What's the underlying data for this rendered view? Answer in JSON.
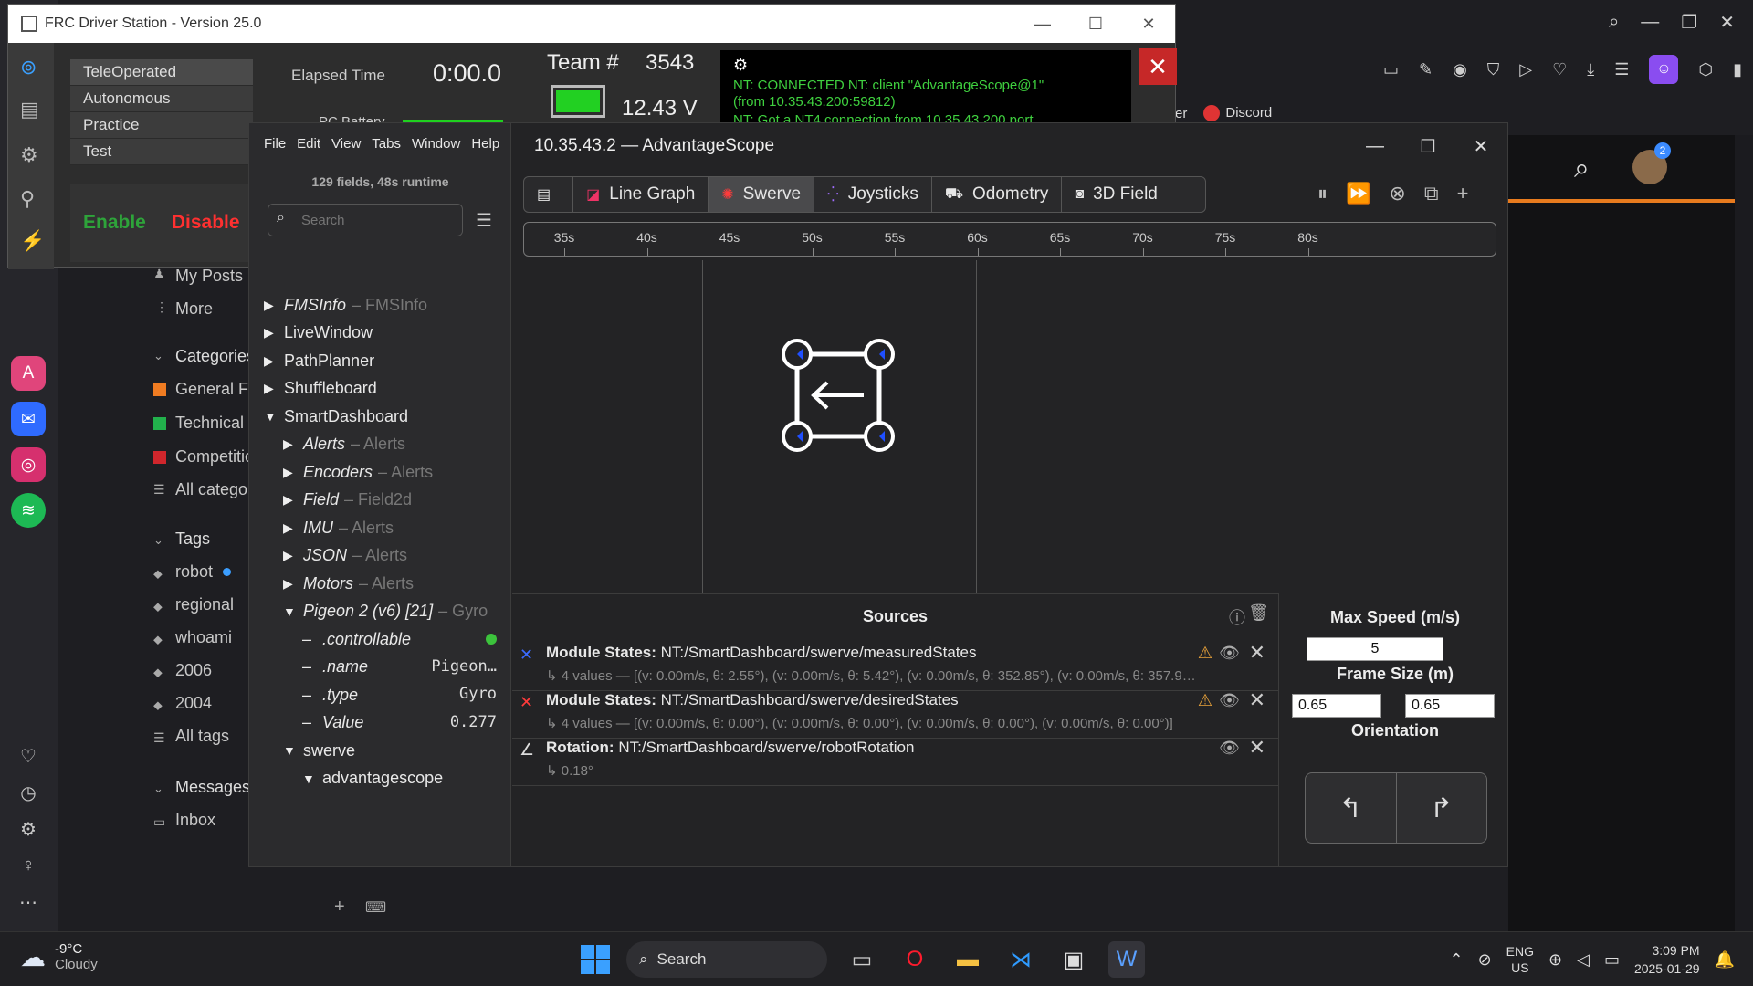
{
  "colors": {
    "green": "#2ecc40",
    "red": "#ff3030",
    "accent_orange": "#e87b1e",
    "module_blue": "#1f4fff"
  },
  "browser": {
    "bookmarks": [
      "ender",
      "Discord"
    ],
    "forum_nav": {
      "my_posts": "My Posts",
      "more": "More",
      "categories_heading": "Categories",
      "categories": [
        "General Fo",
        "Technical",
        "Competitio",
        "All categor"
      ],
      "tags_heading": "Tags",
      "tags": [
        "robot",
        "regional",
        "whoami",
        "2006",
        "2004",
        "All tags"
      ],
      "messages_heading": "Messages",
      "inbox": "Inbox"
    },
    "notification_count": "2"
  },
  "driver_station": {
    "title": "FRC Driver Station - Version 25.0",
    "modes": [
      "TeleOperated",
      "Autonomous",
      "Practice",
      "Test"
    ],
    "enable": "Enable",
    "disable": "Disable",
    "elapsed_label": "Elapsed Time",
    "elapsed_value": "0:00.0",
    "pc_battery_label": "PC Battery",
    "team_label": "Team #",
    "team_number": "3543",
    "voltage": "12.43 V",
    "log_lines": [
      "NT: CONNECTED NT: client \"AdvantageScope@1\"",
      "(from 10.35.43.200:59812)",
      "NT: Got a NT4 connection from 10.35.43.200 port"
    ]
  },
  "advantagescope": {
    "title": "10.35.43.2 — AdvantageScope",
    "menu": [
      "File",
      "Edit",
      "View",
      "Tabs",
      "Window",
      "Help"
    ],
    "fields_info": "129 fields, 48s runtime",
    "search_placeholder": "Search",
    "tree": [
      {
        "label": "FMSInfo",
        "type": "FMSInfo",
        "italic": true,
        "expanded": false,
        "indent": 0
      },
      {
        "label": "LiveWindow",
        "type": "",
        "italic": false,
        "expanded": false,
        "indent": 0
      },
      {
        "label": "PathPlanner",
        "type": "",
        "italic": false,
        "expanded": false,
        "indent": 0
      },
      {
        "label": "Shuffleboard",
        "type": "",
        "italic": false,
        "expanded": false,
        "indent": 0
      },
      {
        "label": "SmartDashboard",
        "type": "",
        "italic": false,
        "expanded": true,
        "indent": 0
      },
      {
        "label": "Alerts",
        "type": "Alerts",
        "italic": true,
        "expanded": false,
        "indent": 1
      },
      {
        "label": "Encoders",
        "type": "Alerts",
        "italic": true,
        "expanded": false,
        "indent": 1
      },
      {
        "label": "Field",
        "type": "Field2d",
        "italic": true,
        "expanded": false,
        "indent": 1
      },
      {
        "label": "IMU",
        "type": "Alerts",
        "italic": true,
        "expanded": false,
        "indent": 1
      },
      {
        "label": "JSON",
        "type": "Alerts",
        "italic": true,
        "expanded": false,
        "indent": 1
      },
      {
        "label": "Motors",
        "type": "Alerts",
        "italic": true,
        "expanded": false,
        "indent": 1
      },
      {
        "label": "Pigeon 2 (v6) [21]",
        "type": "Gyro",
        "italic": true,
        "expanded": true,
        "indent": 1
      }
    ],
    "leaves": [
      {
        "label": ".controllable",
        "value": "",
        "dot": true
      },
      {
        "label": ".name",
        "value": "Pigeon…",
        "dot": false
      },
      {
        "label": ".type",
        "value": "Gyro",
        "dot": false
      },
      {
        "label": "Value",
        "value": "0.277",
        "dot": false
      }
    ],
    "tree_tail": [
      {
        "label": "swerve",
        "indent": 1
      },
      {
        "label": "advantagescope",
        "indent": 2
      }
    ],
    "tabs": [
      "",
      "Line Graph",
      "Swerve",
      "Joysticks",
      "Odometry",
      "3D Field"
    ],
    "active_tab": "Swerve",
    "timeline_ticks": [
      "35s",
      "40s",
      "45s",
      "50s",
      "55s",
      "60s",
      "65s",
      "70s",
      "75s",
      "80s"
    ],
    "sources_title": "Sources",
    "sources": [
      {
        "kind": "Module States:",
        "path": "NT:/SmartDashboard/swerve/measuredStates",
        "detail": "↳ 4 values — [(v: 0.00m/s, θ: 2.55°), (v: 0.00m/s, θ: 5.42°), (v: 0.00m/s, θ: 352.85°), (v: 0.00m/s, θ: 357.9…",
        "color": "#3b6bff",
        "warn": true
      },
      {
        "kind": "Module States:",
        "path": "NT:/SmartDashboard/swerve/desiredStates",
        "detail": "↳ 4 values — [(v: 0.00m/s, θ: 0.00°), (v: 0.00m/s, θ: 0.00°), (v: 0.00m/s, θ: 0.00°), (v: 0.00m/s, θ: 0.00°)]",
        "color": "#ff3b3b",
        "warn": true
      },
      {
        "kind": "Rotation:",
        "path": "NT:/SmartDashboard/swerve/robotRotation",
        "detail": "↳ 0.18°",
        "color": "#dddddd",
        "warn": false
      }
    ],
    "options": {
      "max_speed_label": "Max Speed (m/s)",
      "max_speed": "5",
      "frame_size_label": "Frame Size (m)",
      "frame_w": "0.65",
      "frame_h": "0.65",
      "orientation_label": "Orientation"
    }
  },
  "taskbar": {
    "temp": "-9°C",
    "condition": "Cloudy",
    "search": "Search",
    "lang1": "ENG",
    "lang2": "US",
    "time": "3:09 PM",
    "date": "2025-01-29"
  }
}
